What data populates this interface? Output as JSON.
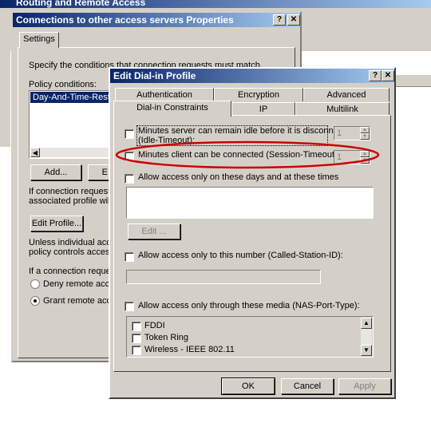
{
  "background_window": {
    "title": "Routing and Remote Access"
  },
  "properties_window": {
    "title": "Connections to other access servers Properties",
    "help": "?",
    "close": "✕",
    "tab": "Settings",
    "desc": "Specify the conditions that connection requests must match.",
    "policy_label": "Policy conditions:",
    "policy_item": "Day-And-Time-Restrict",
    "add_button": "Add...",
    "edit_button_partial": "E",
    "conn_text_line1": "If connection requests",
    "conn_text_line2": "associated profile will b",
    "edit_profile_button": "Edit Profile...",
    "unless_line1": "Unless individual acces",
    "unless_line2": "policy controls access t",
    "if_conn_line": "If a connection request",
    "deny_label": "Deny remote access",
    "grant_label": "Grant remote access",
    "selected": "grant"
  },
  "dialin_dialog": {
    "title": "Edit Dial-in Profile",
    "help": "?",
    "close": "✕",
    "tabs_top": [
      "Authentication",
      "Encryption",
      "Advanced"
    ],
    "tabs_bottom": [
      "Dial-in Constraints",
      "IP",
      "Multilink"
    ],
    "active_tab": "Dial-in Constraints",
    "idle_label_line1": "Minutes server can remain idle before it is disconnected",
    "idle_label_line2": "(Idle-Timeout):",
    "idle_value": "1",
    "session_label": "Minutes client can be connected (Session-Timeout):",
    "session_value": "1",
    "days_label": "Allow access only on these days and at these times",
    "edit_button": "Edit ...",
    "number_label": "Allow access only to this number (Called-Station-ID):",
    "number_value": "",
    "media_label": "Allow access only through these media (NAS-Port-Type):",
    "media_items": [
      "FDDI",
      "Token Ring",
      "Wireless - IEEE 802.11"
    ],
    "ok": "OK",
    "cancel": "Cancel",
    "apply": "Apply",
    "highlight_color": "#cc0000"
  }
}
